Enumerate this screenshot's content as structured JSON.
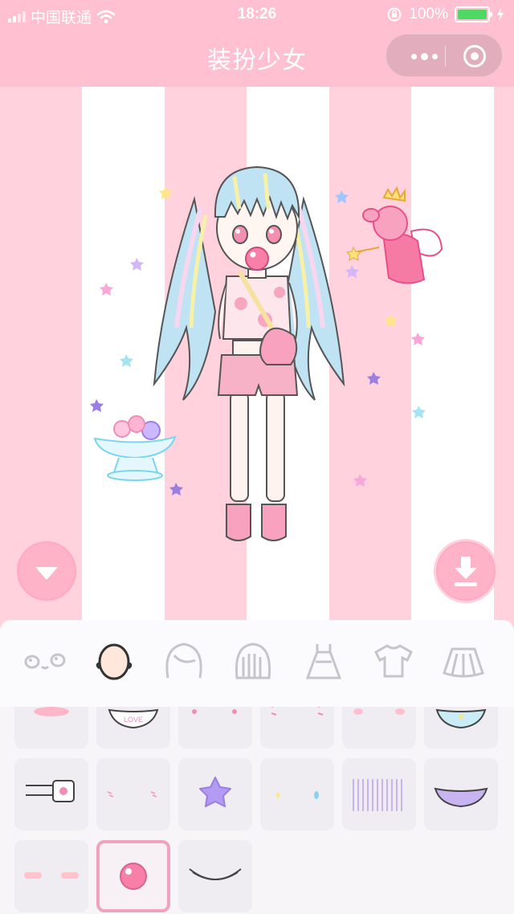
{
  "status_bar": {
    "carrier": "中国联通",
    "time": "18:26",
    "battery": "100%",
    "battery_level": 1.0
  },
  "nav": {
    "title": "装扮少女"
  },
  "stage": {
    "hide_panel_icon": "triangle-down-icon",
    "save_icon": "download-icon"
  },
  "category_tabs": [
    {
      "name": "face-features",
      "icon": "face-icon",
      "selected": false
    },
    {
      "name": "head",
      "icon": "bald-head-icon",
      "selected": true
    },
    {
      "name": "hair-front",
      "icon": "hair-bangs-icon",
      "selected": false
    },
    {
      "name": "hair-back",
      "icon": "hair-back-icon",
      "selected": false
    },
    {
      "name": "dress",
      "icon": "dress-icon",
      "selected": false
    },
    {
      "name": "top",
      "icon": "tshirt-icon",
      "selected": false
    },
    {
      "name": "skirt",
      "icon": "skirt-icon",
      "selected": false
    }
  ],
  "items_grid": {
    "selected_index": 13,
    "items": [
      {
        "name": "pink-blush-item"
      },
      {
        "name": "love-mask-item",
        "label": "LOVE"
      },
      {
        "name": "star-cheeks-item"
      },
      {
        "name": "dash-blush-item"
      },
      {
        "name": "soft-blush-item"
      },
      {
        "name": "blue-mask-item"
      },
      {
        "name": "bandage-item"
      },
      {
        "name": "tiny-blush-item"
      },
      {
        "name": "purple-star-item"
      },
      {
        "name": "tear-drops-item"
      },
      {
        "name": "stripes-shadow-item"
      },
      {
        "name": "purple-mask-item"
      },
      {
        "name": "oval-blush-item"
      },
      {
        "name": "bubble-gum-item"
      },
      {
        "name": "smile-item"
      }
    ]
  },
  "colors": {
    "nav_bg": "#ffc0d1",
    "stripe_pink": "#ffd2de",
    "accent": "#ffb3c9",
    "selected_border": "#f0a3bf"
  }
}
